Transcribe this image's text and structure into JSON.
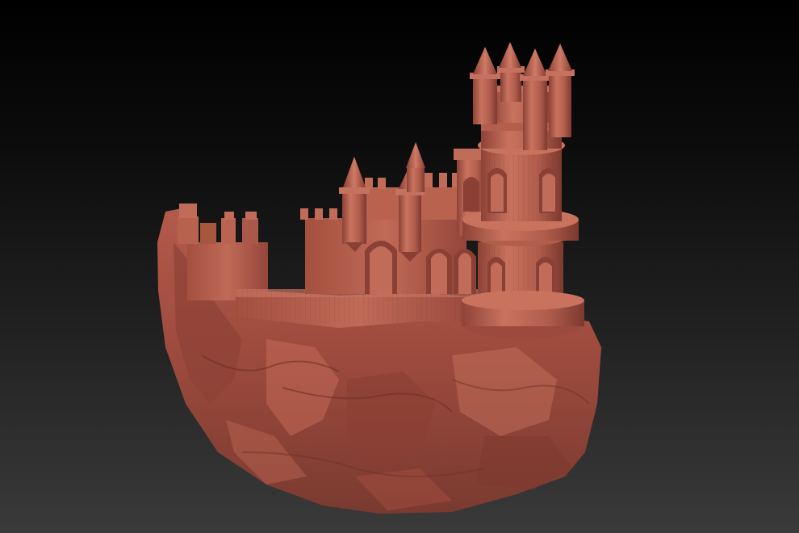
{
  "scene": {
    "background_top": "#000000",
    "background_bottom": "#3a3a3a",
    "model_color": "#b45b4c",
    "model_shadow": "#6a2d24",
    "model_highlight": "#d98a78"
  }
}
